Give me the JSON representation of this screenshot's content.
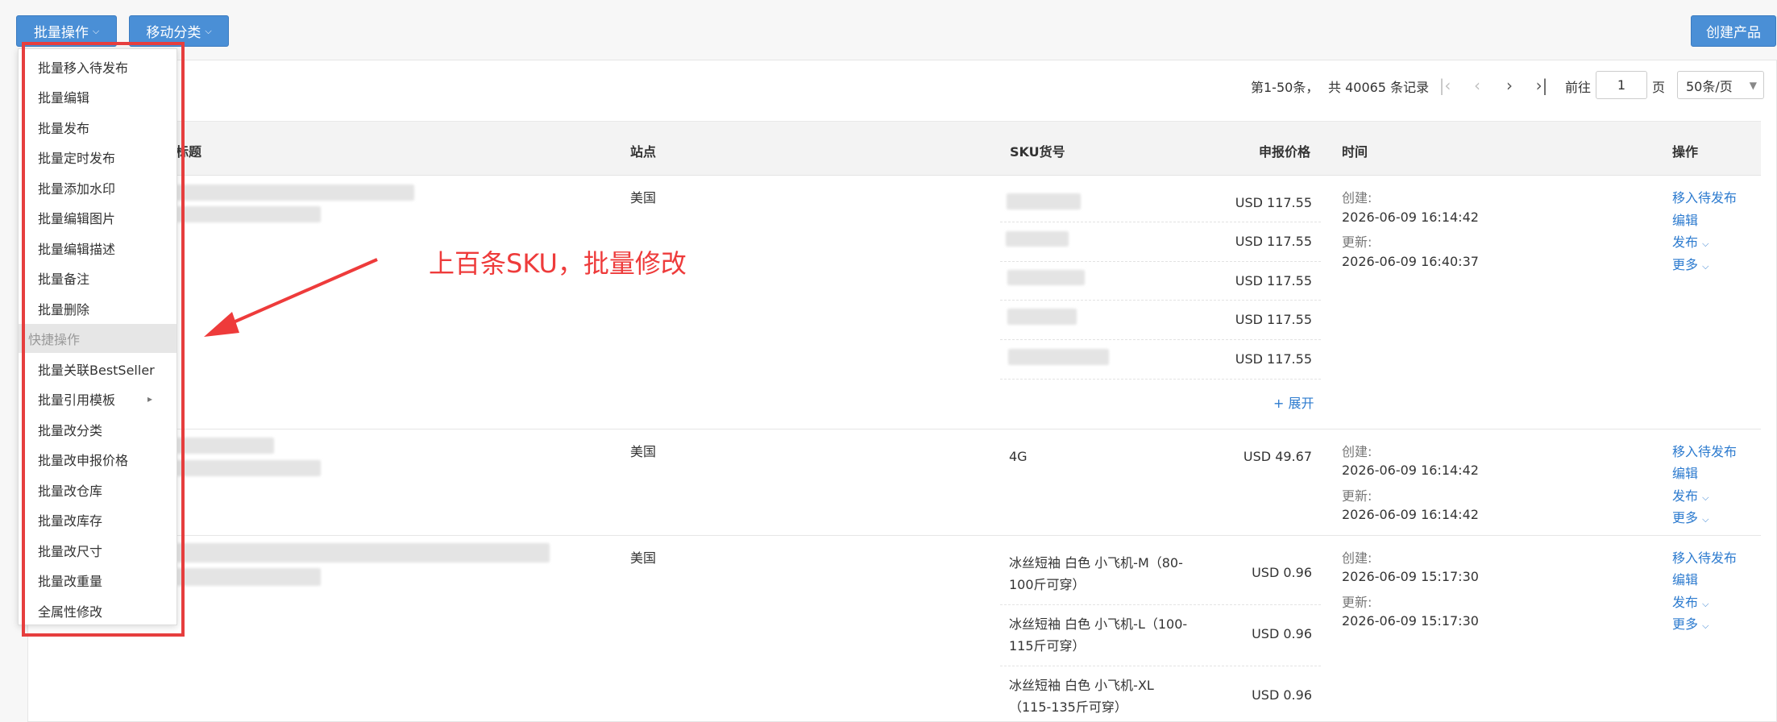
{
  "toolbar": {
    "batch_ops_label": "批量操作",
    "move_category_label": "移动分类",
    "create_product_label": "创建产品"
  },
  "pagination": {
    "range_text": "第1-50条，",
    "total_text": "共 40065 条记录",
    "goto_label": "前往",
    "page_value": "1",
    "page_unit": "页",
    "page_size": "50条/页"
  },
  "table": {
    "headers": {
      "title": "标题",
      "site": "站点",
      "sku": "SKU货号",
      "price": "申报价格",
      "time": "时间",
      "actions": "操作"
    },
    "rows": [
      {
        "site": "美国",
        "skus": [
          {
            "price": "USD 117.55"
          },
          {
            "price": "USD 117.55"
          },
          {
            "price": "USD 117.55"
          },
          {
            "price": "USD 117.55"
          },
          {
            "price": "USD 117.55"
          }
        ],
        "expand_label": "+ 展开",
        "created_label": "创建:",
        "created_time": "2026-06-09 16:14:42",
        "updated_label": "更新:",
        "updated_time": "2026-06-09 16:40:37",
        "actions": {
          "move": "移入待发布",
          "edit": "编辑",
          "publish": "发布",
          "more": "更多"
        }
      },
      {
        "site": "美国",
        "skus": [
          {
            "code": "4G",
            "price": "USD 49.67"
          }
        ],
        "created_label": "创建:",
        "created_time": "2026-06-09 16:14:42",
        "updated_label": "更新:",
        "updated_time": "2026-06-09 16:14:42",
        "actions": {
          "move": "移入待发布",
          "edit": "编辑",
          "publish": "发布",
          "more": "更多"
        }
      },
      {
        "site": "美国",
        "skus": [
          {
            "code": "冰丝短袖 白色 小飞机-M（80-100斤可穿）",
            "price": "USD 0.96"
          },
          {
            "code": "冰丝短袖 白色 小飞机-L（100-115斤可穿）",
            "price": "USD 0.96"
          },
          {
            "code": "冰丝短袖 白色 小飞机-XL（115-135斤可穿）",
            "price": "USD 0.96"
          }
        ],
        "created_label": "创建:",
        "created_time": "2026-06-09 15:17:30",
        "updated_label": "更新:",
        "updated_time": "2026-06-09 15:17:30",
        "actions": {
          "move": "移入待发布",
          "edit": "编辑",
          "publish": "发布",
          "more": "更多"
        }
      }
    ]
  },
  "batch_menu": {
    "items": [
      "批量移入待发布",
      "批量编辑",
      "批量发布",
      "批量定时发布",
      "批量添加水印",
      "批量编辑图片",
      "批量编辑描述",
      "批量备注",
      "批量删除"
    ],
    "group_label": "快捷操作",
    "quick_items": [
      "批量关联BestSeller",
      "批量引用模板",
      "批量改分类",
      "批量改申报价格",
      "批量改仓库",
      "批量改库存",
      "批量改尺寸",
      "批量改重量",
      "全属性修改"
    ]
  },
  "annotation": {
    "text": "上百条SKU，批量修改",
    "color": "#ee3b3b"
  },
  "icons": {
    "first_page": "first-page-icon",
    "prev_page": "prev-page-icon",
    "next_page": "next-page-icon",
    "last_page": "last-page-icon"
  },
  "colors": {
    "primary": "#4a8fd6",
    "link": "#2d7bcf",
    "highlight": "#e63e3e"
  }
}
